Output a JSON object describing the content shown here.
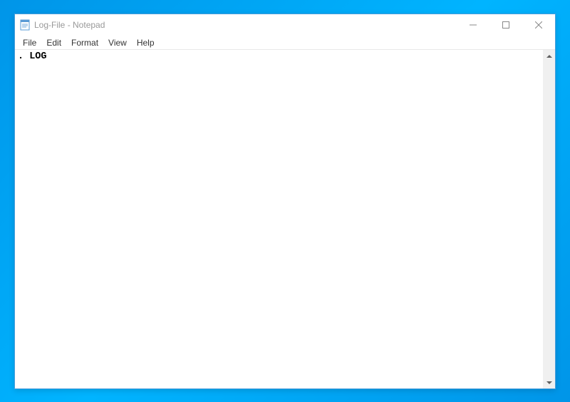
{
  "window": {
    "title": "Log-File - Notepad"
  },
  "menubar": {
    "items": [
      "File",
      "Edit",
      "Format",
      "View",
      "Help"
    ]
  },
  "editor": {
    "content": ". LOG"
  }
}
